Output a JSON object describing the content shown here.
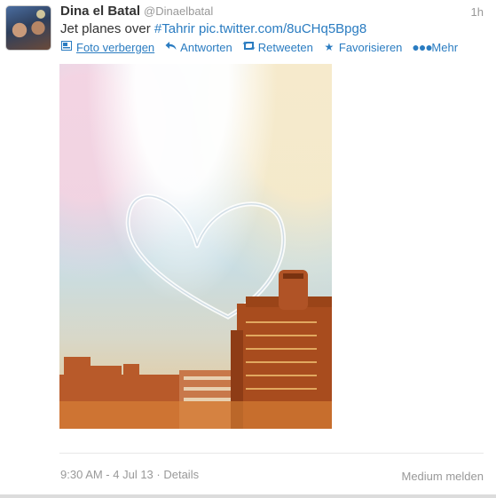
{
  "tweet": {
    "fullname": "Dina el Batal",
    "username": "@Dinaelbatal",
    "time": "1h",
    "text_prefix": "Jet planes over ",
    "hashtag": "#Tahrir",
    "link": "pic.twitter.com/8uCHq5Bpg8",
    "actions": {
      "hide_photo": "Foto verbergen",
      "reply": "Antworten",
      "retweet": "Retweeten",
      "favorite": "Favorisieren",
      "more": "Mehr"
    },
    "timestamp": "9:30 AM - 4 Jul 13",
    "details": "Details",
    "report": "Medium melden"
  },
  "icons": {
    "hide_photo": "photo-icon",
    "reply": "reply-arrow-icon",
    "retweet": "retweet-icon",
    "favorite": "star-icon",
    "more": "ellipsis-icon"
  },
  "colors": {
    "link": "#2a7cc1",
    "muted": "#999999",
    "text": "#333333"
  }
}
